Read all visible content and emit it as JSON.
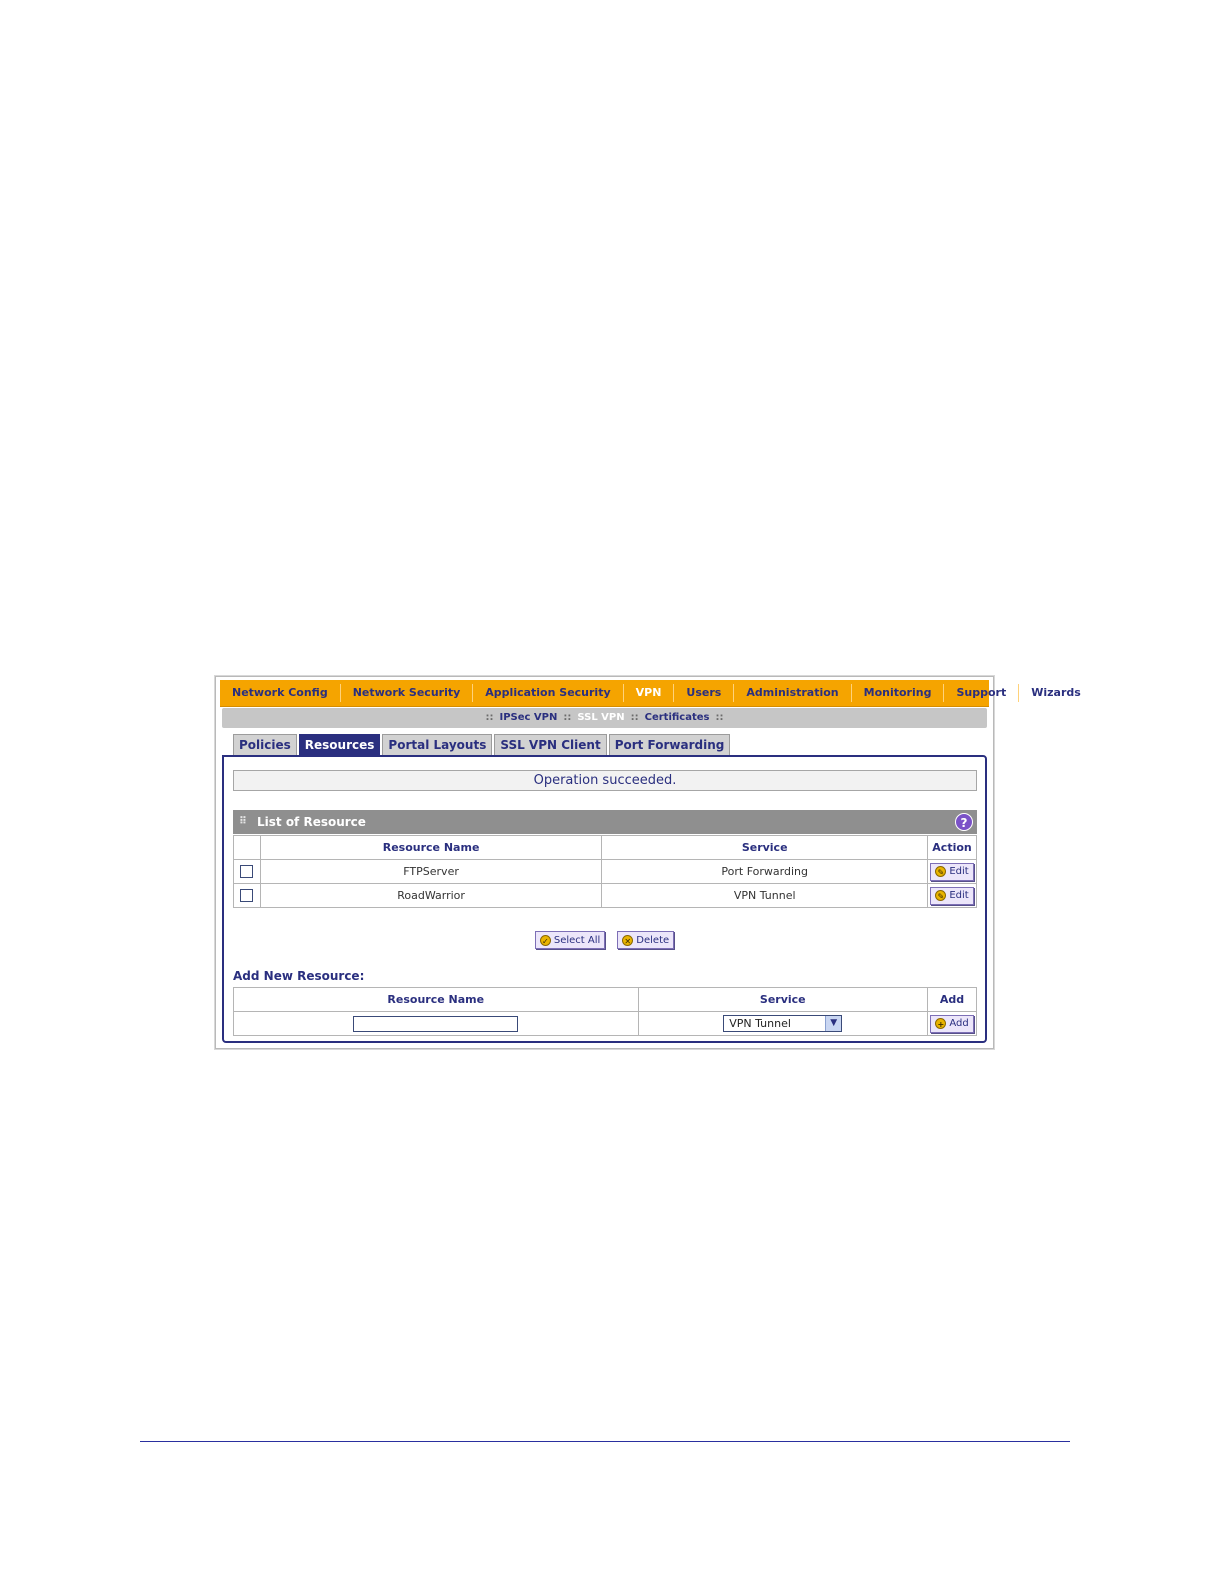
{
  "top_nav": {
    "items": [
      {
        "label": "Network Config"
      },
      {
        "label": "Network Security"
      },
      {
        "label": "Application Security"
      },
      {
        "label": "VPN"
      },
      {
        "label": "Users"
      },
      {
        "label": "Administration"
      },
      {
        "label": "Monitoring"
      },
      {
        "label": "Support"
      },
      {
        "label": "Wizards"
      }
    ],
    "active": "VPN"
  },
  "sub_nav": {
    "items": [
      {
        "label": "IPSec VPN"
      },
      {
        "label": "SSL VPN"
      },
      {
        "label": "Certificates"
      }
    ],
    "active": "SSL VPN"
  },
  "tabs": [
    {
      "label": "Policies"
    },
    {
      "label": "Resources"
    },
    {
      "label": "Portal Layouts"
    },
    {
      "label": "SSL VPN Client"
    },
    {
      "label": "Port Forwarding"
    }
  ],
  "active_tab": "Resources",
  "status_message": "Operation succeeded.",
  "resource_list": {
    "title": "List of Resource",
    "help_icon": "?",
    "columns": {
      "name": "Resource Name",
      "service": "Service",
      "action": "Action"
    },
    "rows": [
      {
        "name": "FTPServer",
        "service": "Port Forwarding",
        "action": "Edit"
      },
      {
        "name": "RoadWarrior",
        "service": "VPN Tunnel",
        "action": "Edit"
      }
    ]
  },
  "buttons": {
    "select_all": "Select All",
    "delete": "Delete"
  },
  "add_new": {
    "title": "Add New Resource:",
    "columns": {
      "name": "Resource Name",
      "service": "Service",
      "add": "Add"
    },
    "name_value": "",
    "service_value": "VPN Tunnel",
    "add_button": "Add"
  },
  "colors": {
    "nav_bg": "#f5a400",
    "accent": "#2a2f7f",
    "subnav_bg": "#c6c6c6"
  }
}
